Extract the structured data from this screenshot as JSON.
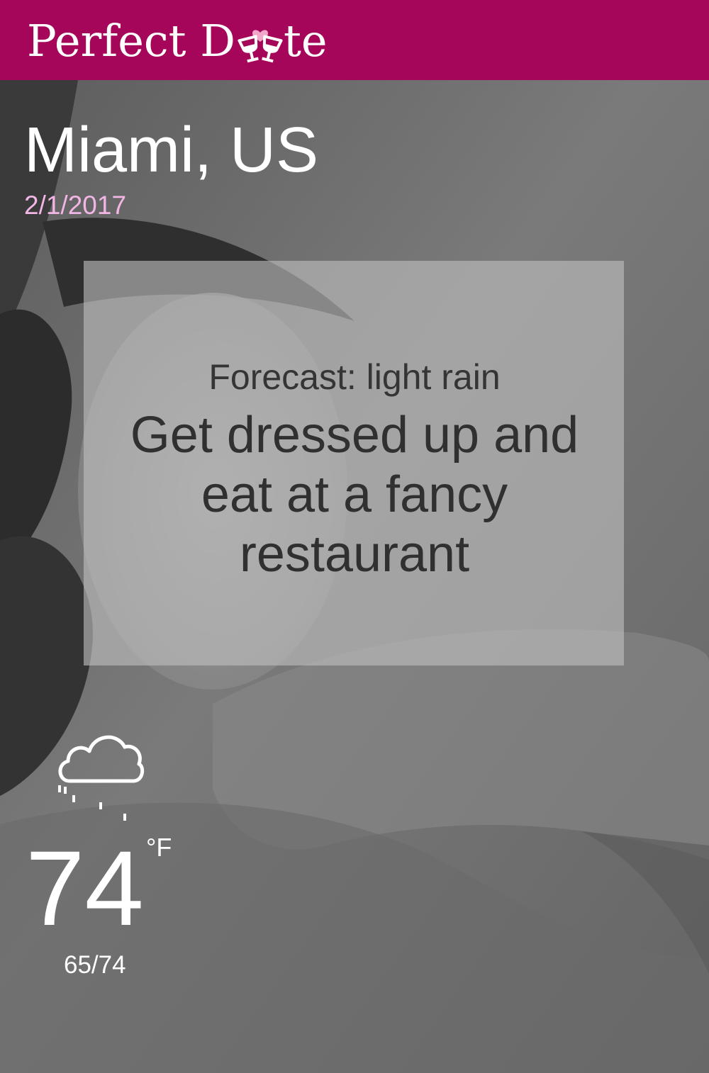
{
  "app": {
    "title": "Perfect Date",
    "brand_color": "#a5065a"
  },
  "location": {
    "city": "Miami, US",
    "date": "2/1/2017"
  },
  "forecast": {
    "label": "Forecast: light rain",
    "suggestion": "Get dressed up and eat at a fancy restaurant"
  },
  "weather": {
    "icon": "rain-cloud-icon",
    "temperature": "74",
    "unit": "°F",
    "range": "65/74"
  },
  "colors": {
    "date_text": "#f2b6e6",
    "text_primary": "#ffffff",
    "card_text": "#303030"
  }
}
